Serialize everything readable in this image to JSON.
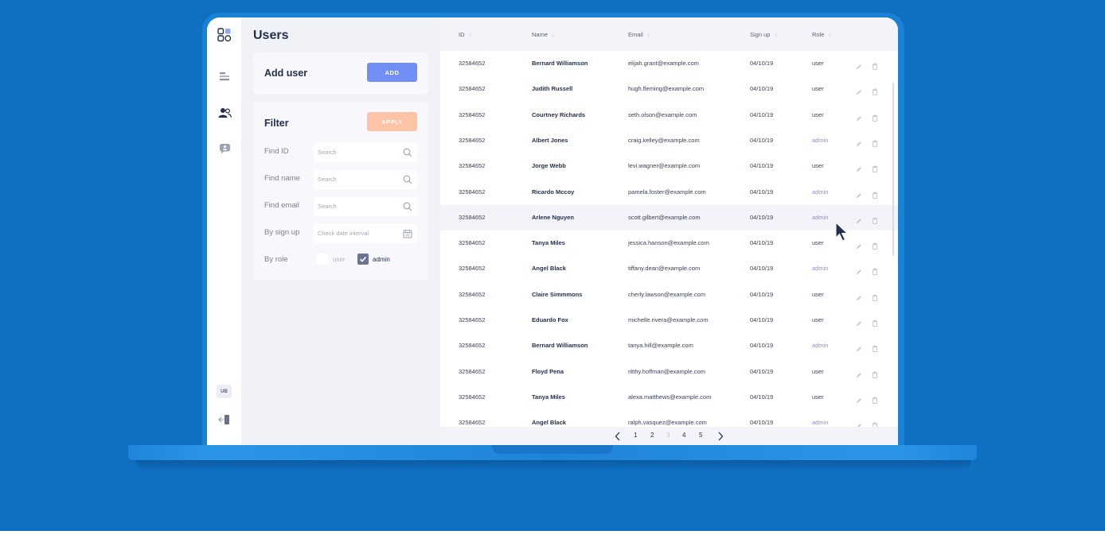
{
  "colors": {
    "background": "#0f6fc0",
    "accent_blue": "#6f8ff5",
    "accent_orange": "#fdc3a6",
    "admin_purple": "#8b86ea",
    "title": "#23304d"
  },
  "rail": {
    "icons": [
      "dashboard-icon",
      "list-icon",
      "users-icon",
      "chat-icon"
    ],
    "avatar_initials": "UB",
    "logout_icon": "logout-icon"
  },
  "page": {
    "title": "Users"
  },
  "add_user": {
    "title": "Add user",
    "button": "ADD"
  },
  "filter": {
    "title": "Filter",
    "apply_button": "APPLY",
    "fields": [
      {
        "label": "Find ID",
        "placeholder": "Search",
        "icon": "search-icon"
      },
      {
        "label": "Find name",
        "placeholder": "Search",
        "icon": "search-icon"
      },
      {
        "label": "Find email",
        "placeholder": "Search",
        "icon": "search-icon"
      },
      {
        "label": "By sign up",
        "placeholder": "Check date interval",
        "icon": "calendar-icon"
      }
    ],
    "role": {
      "label": "By role",
      "options": [
        {
          "label": "user",
          "checked": false
        },
        {
          "label": "admin",
          "checked": true
        }
      ]
    }
  },
  "table": {
    "columns": [
      "ID",
      "Name",
      "Email",
      "Sign up",
      "Role"
    ],
    "rows": [
      {
        "id": "32584652",
        "name": "Bernard Williamson",
        "email": "elijah.grant@example.com",
        "signup": "04/10/19",
        "role": "user"
      },
      {
        "id": "32584652",
        "name": "Judith Russell",
        "email": "hugh.fleming@example.com",
        "signup": "04/10/19",
        "role": "user"
      },
      {
        "id": "32584652",
        "name": "Courtney Richards",
        "email": "seth.olson@example.com",
        "signup": "04/10/19",
        "role": "user"
      },
      {
        "id": "32584652",
        "name": "Albert Jones",
        "email": "craig.kelley@example.com",
        "signup": "04/10/19",
        "role": "admin"
      },
      {
        "id": "32584652",
        "name": "Jorge Webb",
        "email": "levi.wagner@example.com",
        "signup": "04/10/19",
        "role": "user"
      },
      {
        "id": "32584652",
        "name": "Ricardo Mccoy",
        "email": "pamela.foster@example.com",
        "signup": "04/10/19",
        "role": "admin"
      },
      {
        "id": "32584652",
        "name": "Arlene Nguyen",
        "email": "scott.gilbert@example.com",
        "signup": "04/10/19",
        "role": "admin",
        "highlighted": true
      },
      {
        "id": "32584652",
        "name": "Tanya Miles",
        "email": "jessica.hanson@example.com",
        "signup": "04/10/19",
        "role": "user"
      },
      {
        "id": "32584652",
        "name": "Angel Black",
        "email": "tiffany.dean@example.com",
        "signup": "04/10/19",
        "role": "admin"
      },
      {
        "id": "32584652",
        "name": "Claire Simmmons",
        "email": "cherly.lawson@example.com",
        "signup": "04/10/19",
        "role": "user"
      },
      {
        "id": "32584652",
        "name": "Eduardo Fox",
        "email": "michelle.rivera@example.com",
        "signup": "04/10/19",
        "role": "user"
      },
      {
        "id": "32584652",
        "name": "Bernard Williamson",
        "email": "tanya.hill@example.com",
        "signup": "04/10/19",
        "role": "admin"
      },
      {
        "id": "32584652",
        "name": "Floyd Pena",
        "email": "ritthy.hoffman@example.com",
        "signup": "04/10/19",
        "role": "user"
      },
      {
        "id": "32584652",
        "name": "Tanya Miles",
        "email": "alexa.matthews@example.com",
        "signup": "04/10/19",
        "role": "user"
      },
      {
        "id": "32584652",
        "name": "Angel Black",
        "email": "ralph.vasquez@example.com",
        "signup": "04/10/19",
        "role": "admin"
      }
    ],
    "row_actions": [
      "edit-icon",
      "delete-icon"
    ]
  },
  "pagination": {
    "pages": [
      "1",
      "2",
      "3",
      "4",
      "5"
    ],
    "current": "3"
  }
}
